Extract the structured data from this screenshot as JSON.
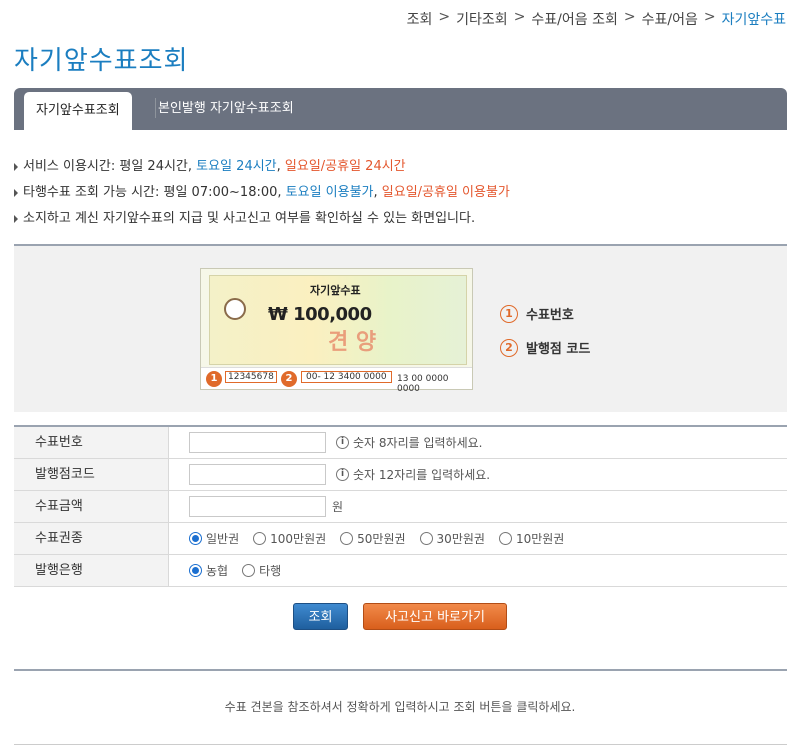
{
  "breadcrumb": {
    "items": [
      "조회",
      "기타조회",
      "수표/어음 조회",
      "수표/어음"
    ],
    "current": "자기앞수표",
    "separator": ">"
  },
  "page": {
    "title": "자기앞수표조회"
  },
  "tabs": [
    {
      "label": "자기앞수표조회"
    },
    {
      "label": "본인발행 자기앞수표조회"
    }
  ],
  "notes": {
    "line1": {
      "prefix": "서비스 이용시간: 평일 24시간, ",
      "blue": "토요일 24시간",
      "comma": ", ",
      "orange": "일요일/공휴일 24시간"
    },
    "line2": {
      "prefix": "타행수표 조회 가능 시간: 평일 07:00~18:00, ",
      "blue": "토요일 이용불가",
      "comma": ", ",
      "orange": "일요일/공휴일 이용불가"
    },
    "line3": "소지하고 계신 자기앞수표의 지급 및 사고신고 여부를 확인하실 수 있는 화면입니다."
  },
  "sample_check": {
    "title": "자기앞수표",
    "amount": "₩ 100,000",
    "seal_text": "견 양",
    "bottom": {
      "number": "12345678",
      "code": "00-  12  3400   0000",
      "tail": "13 00 0000 0000"
    },
    "markers": [
      "1",
      "2"
    ]
  },
  "legend": [
    {
      "num": "1",
      "label": "수표번호"
    },
    {
      "num": "2",
      "label": "발행점 코드"
    }
  ],
  "form": {
    "check_number": {
      "label": "수표번호",
      "value": "",
      "hint": "숫자 8자리를 입력하세요."
    },
    "branch_code": {
      "label": "발행점코드",
      "value": "",
      "hint": "숫자 12자리를 입력하세요."
    },
    "amount": {
      "label": "수표금액",
      "value": "",
      "unit": "원"
    },
    "denomination": {
      "label": "수표권종",
      "options": [
        "일반권",
        "100만원권",
        "50만원권",
        "30만원권",
        "10만원권"
      ],
      "selected": "일반권"
    },
    "bank": {
      "label": "발행은행",
      "options": [
        "농협",
        "타행"
      ],
      "selected": "농협"
    }
  },
  "buttons": {
    "search": "조회",
    "report": "사고신고 바로가기"
  },
  "footer": {
    "text": "수표 견본을 참조하셔서 정확하게 입력하시고 조회 버튼을 클릭하세요."
  },
  "colors": {
    "accent": "#1b7ec0",
    "orange": "#e4572e",
    "tabbar": "#6b7280",
    "button_blue": "#2a6fb4",
    "button_orange": "#e5702e"
  }
}
